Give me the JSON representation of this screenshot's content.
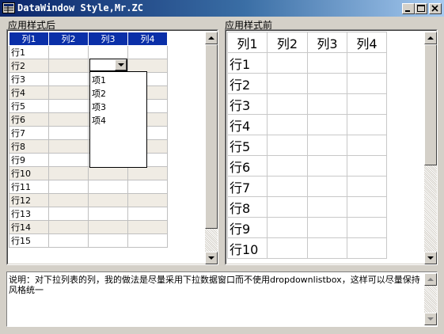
{
  "window": {
    "title": "DataWindow Style,Mr.ZC",
    "title_bg": "#0a246a",
    "minimize_icon": "minimize-icon",
    "maximize_icon": "maximize-icon",
    "close_icon": "close-icon"
  },
  "left_panel": {
    "label": "应用样式后",
    "header_bg": "#0a2fa8",
    "columns": [
      "列1",
      "列2",
      "列3",
      "列4"
    ],
    "rows": [
      "行1",
      "行2",
      "行3",
      "行4",
      "行5",
      "行6",
      "行7",
      "行8",
      "行9",
      "行10",
      "行11",
      "行12",
      "行13",
      "行14",
      "行15"
    ],
    "dropdown": {
      "row": "行2",
      "column": "列3",
      "options": [
        "项1",
        "项2",
        "项3",
        "项4"
      ]
    }
  },
  "right_panel": {
    "label": "应用样式前",
    "columns": [
      "列1",
      "列2",
      "列3",
      "列4"
    ],
    "rows": [
      "行1",
      "行2",
      "行3",
      "行4",
      "行5",
      "行6",
      "行7",
      "行8",
      "行9",
      "行10"
    ]
  },
  "description": {
    "text": "说明：对下拉列表的列，我的做法是尽量采用下拉数据窗口而不使用dropdownlistbox，这样可以尽量保持风格统一"
  }
}
